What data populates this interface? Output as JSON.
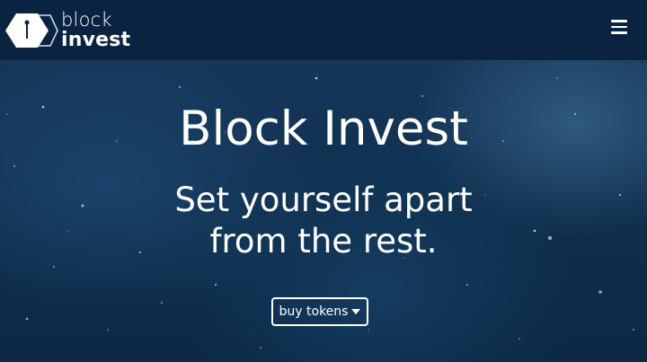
{
  "navbar": {
    "logo_line1": "block",
    "logo_line2": "invest",
    "menu_icon": "hamburger-menu-icon"
  },
  "hero": {
    "title": "Block Invest",
    "subtitle_line1": "Set yourself apart",
    "subtitle_line2": "from the rest.",
    "cta_label": "buy tokens",
    "cta_icon": "caret-down-icon"
  },
  "colors": {
    "navbar_bg": "#0a2341",
    "hero_bg": "#12304f",
    "text": "#ffffff"
  }
}
